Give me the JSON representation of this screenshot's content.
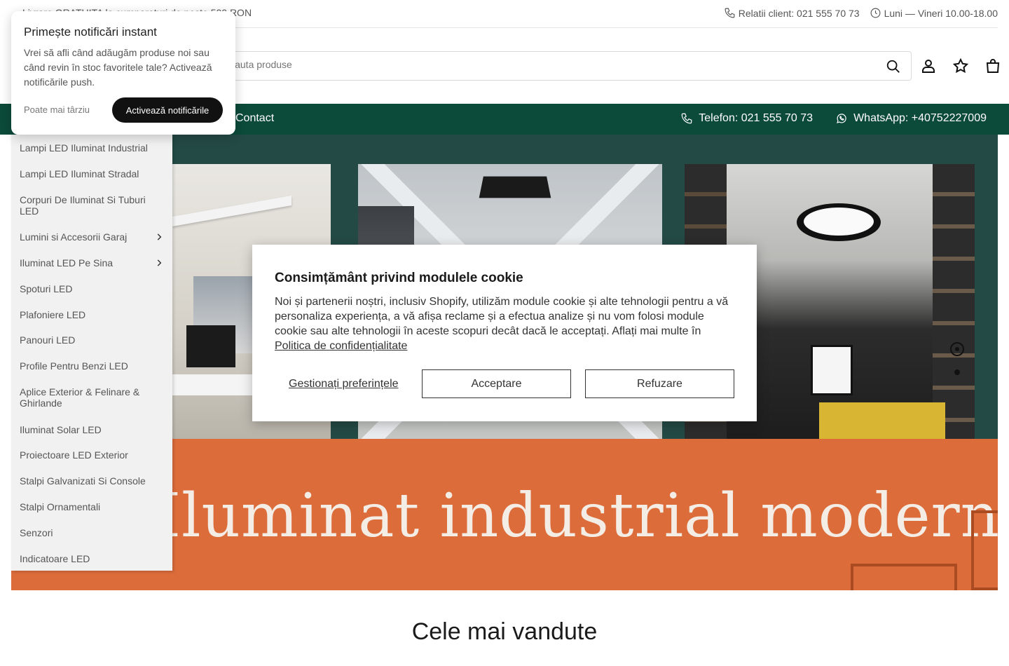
{
  "topbar": {
    "promo": "Livrare GRATUITA la cumparaturi de peste 500 RON",
    "support": "Relatii client: 021 555 70 73",
    "hours": "Luni — Vineri 10.00-18.00"
  },
  "search": {
    "placeholder": "Cauta produse"
  },
  "navbar": {
    "contact": "Contact",
    "phone": "Telefon: 021 555 70 73",
    "whatsapp": "WhatsApp: +40752227009",
    "background": "#0c4a39"
  },
  "sidebar": {
    "items": [
      {
        "label": "Lampi LED Iluminat Industrial"
      },
      {
        "label": "Lampi LED Iluminat Stradal"
      },
      {
        "label": "Corpuri De Iluminat Si Tuburi LED"
      },
      {
        "label": "Lumini si Accesorii Garaj",
        "has_submenu": true
      },
      {
        "label": "Iluminat LED Pe Sina",
        "has_submenu": true
      },
      {
        "label": "Spoturi LED"
      },
      {
        "label": "Plafoniere LED"
      },
      {
        "label": "Panouri LED"
      },
      {
        "label": "Profile Pentru Benzi LED"
      },
      {
        "label": "Aplice Exterior & Felinare & Ghirlande"
      },
      {
        "label": "Iluminat Solar LED"
      },
      {
        "label": "Proiectoare LED Exterior"
      },
      {
        "label": "Stalpi Galvanizati Si Console"
      },
      {
        "label": "Stalpi Ornamentali"
      },
      {
        "label": "Senzori"
      },
      {
        "label": "Indicatoare LED"
      }
    ]
  },
  "hero": {
    "banner_text": "Iluminat industrial modern",
    "colors": {
      "top": "#244a45",
      "bottom": "#dc6c3a"
    },
    "slide_count": 2,
    "active_slide": 1
  },
  "section": {
    "title": "Cele mai vandute"
  },
  "push_popup": {
    "title": "Primește notificări instant",
    "body": "Vrei să afli când adăugăm produse noi sau când revin în stoc favoritele tale? Activează notificările push.",
    "later": "Poate mai târziu",
    "activate": "Activează notificările"
  },
  "cookie_modal": {
    "title": "Consimțământ privind modulele cookie",
    "text": "Noi și partenerii noștri, inclusiv Shopify, utilizăm module cookie și alte tehnologii pentru a vă personaliza experiența, a vă afișa reclame și a efectua analize și nu vom folosi module cookie sau alte tehnologii în aceste scopuri decât dacă le acceptați. Aflați mai multe în",
    "policy_link": "Politica de confidențialitate",
    "manage": "Gestionați preferințele",
    "accept": "Acceptare",
    "refuse": "Refuzare"
  }
}
